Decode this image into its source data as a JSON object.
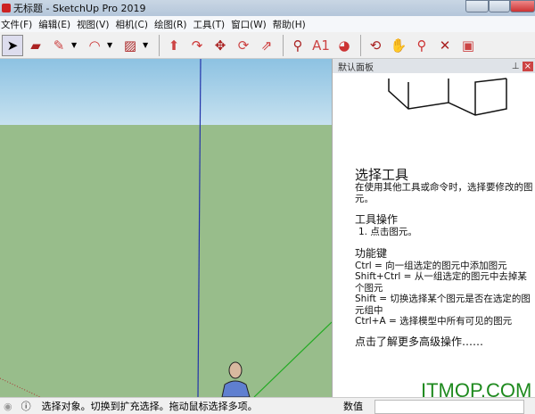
{
  "window": {
    "title": "无标题 - SketchUp Pro 2019"
  },
  "menu": [
    "文件(F)",
    "编辑(E)",
    "视图(V)",
    "相机(C)",
    "绘图(R)",
    "工具(T)",
    "窗口(W)",
    "帮助(H)"
  ],
  "toolbar": [
    {
      "icon": "select-arrow-icon",
      "glyph": "➤"
    },
    {
      "icon": "eraser-icon",
      "glyph": "▰"
    },
    {
      "icon": "pencil-icon",
      "glyph": "✎",
      "dd": true
    },
    {
      "icon": "arc-icon",
      "glyph": "◠",
      "dd": true
    },
    {
      "icon": "rectangle-icon",
      "glyph": "▨",
      "dd": true
    },
    {
      "icon": "push-pull-icon",
      "glyph": "⬆"
    },
    {
      "icon": "follow-me-icon",
      "glyph": "↷"
    },
    {
      "icon": "move-icon",
      "glyph": "✥"
    },
    {
      "icon": "rotate-icon",
      "glyph": "⟳"
    },
    {
      "icon": "scale-icon",
      "glyph": "⇗"
    },
    {
      "icon": "tape-measure-icon",
      "glyph": "⚲"
    },
    {
      "icon": "text-icon",
      "glyph": "A1"
    },
    {
      "icon": "paint-bucket-icon",
      "glyph": "◕"
    },
    {
      "icon": "orbit-icon",
      "glyph": "⟲"
    },
    {
      "icon": "pan-icon",
      "glyph": "✋"
    },
    {
      "icon": "zoom-icon",
      "glyph": "⚲"
    },
    {
      "icon": "zoom-extents-icon",
      "glyph": "✕"
    },
    {
      "icon": "warehouse-icon",
      "glyph": "▣"
    }
  ],
  "panel": {
    "title": "默认面板",
    "heading": "选择工具",
    "intro": "在使用其他工具或命令时，选择要修改的图元。",
    "ops_title": "工具操作",
    "ops": "1. 点击图元。",
    "keys_title": "功能键",
    "keys": [
      "Ctrl = 向一组选定的图元中添加图元",
      "Shift+Ctrl = 从一组选定的图元中去掉某个图元",
      "Shift = 切换选择某个图元是否在选定的图元组中",
      "Ctrl+A = 选择模型中所有可见的图元"
    ],
    "more": "点击了解更多高级操作……"
  },
  "status": {
    "message": "选择对象。切换到扩充选择。拖动鼠标选择多项。",
    "measure_label": "数值",
    "measure_value": ""
  },
  "watermark": "ITMOP.COM",
  "colors": {
    "sky": "#8dc2e2",
    "ground": "#98bd8b",
    "axis_blue": "#2233aa",
    "axis_green": "#22aa22",
    "axis_red": "#aa3333"
  }
}
